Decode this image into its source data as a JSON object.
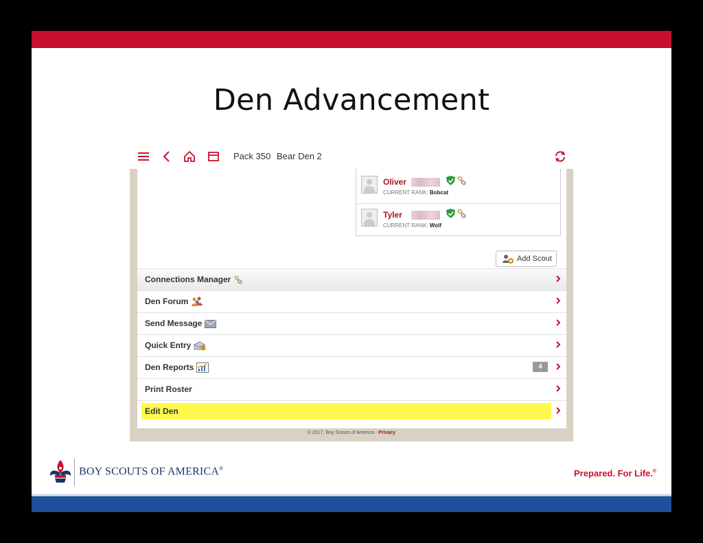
{
  "slide": {
    "title": "Den Advancement",
    "brand_name": "BOY SCOUTS OF AMERICA",
    "brand_mark": "®",
    "tagline": "Prepared. For Life.",
    "tagline_mark": "®",
    "colors": {
      "red": "#c8102e",
      "blue": "#1d4f9c",
      "highlight": "#fff94d"
    }
  },
  "header": {
    "icons": [
      "menu-icon",
      "back-icon",
      "home-icon",
      "window-icon",
      "refresh-icon"
    ],
    "pack": "Pack 350",
    "den": "Bear Den 2"
  },
  "roster": [
    {
      "name": "Oliver",
      "rank_label": "CURRENT RANK:",
      "rank": "Bobcat"
    },
    {
      "name": "Tyler",
      "rank_label": "CURRENT RANK:",
      "rank": "Wolf"
    }
  ],
  "add_scout": "Add Scout",
  "menu": [
    {
      "label": "Connections Manager",
      "icon": "link-icon"
    },
    {
      "label": "Den Forum",
      "icon": "people-icon"
    },
    {
      "label": "Send Message",
      "icon": "envelope-icon"
    },
    {
      "label": "Quick Entry",
      "icon": "quick-entry-icon"
    },
    {
      "label": "Den Reports",
      "icon": "chart-icon",
      "badge": "4"
    },
    {
      "label": "Print Roster"
    },
    {
      "label": "Edit Den"
    }
  ],
  "footer": {
    "copyright": "© 2017, Boy Scouts of America - ",
    "privacy": "Privacy"
  }
}
